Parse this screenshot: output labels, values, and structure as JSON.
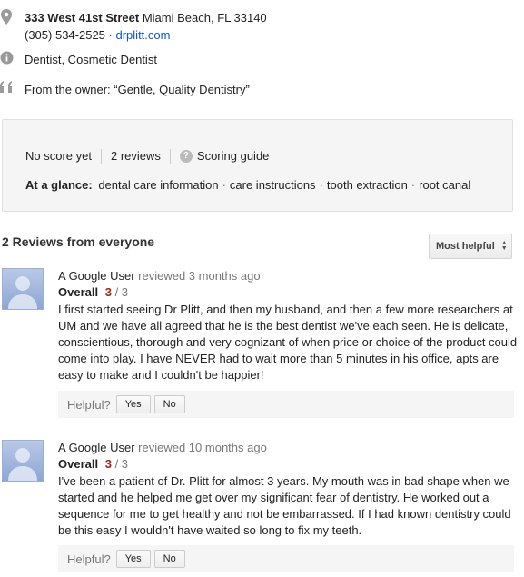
{
  "place": {
    "street": "333 West 41st Street",
    "city": "Miami Beach, FL 33140",
    "phone": "(305) 534-2525",
    "separator": "·",
    "website": "drplitt.com",
    "categories": "Dentist, Cosmetic Dentist",
    "owner_quote": "From the owner: “Gentle, Quality Dentistry”"
  },
  "score": {
    "status": "No score yet",
    "reviews_count": "2 reviews",
    "guide_label": "Scoring guide",
    "glance_label": "At a glance:",
    "glance_items": [
      "dental care information",
      "care instructions",
      "tooth extraction",
      "root canal"
    ]
  },
  "reviews_section": {
    "heading": "2 Reviews from everyone",
    "sort_label": "Most helpful"
  },
  "reviews": [
    {
      "author": "A Google User",
      "meta": "reviewed 3 months ago",
      "overall_label": "Overall",
      "score": "3",
      "outof": "/ 3",
      "text": "I first started seeing Dr Plitt, and then my husband, and then a few more researchers at UM and we have all agreed that he is the best dentist we've each seen. He is delicate, conscientious, thorough and very cognizant of when price or choice of the product could come into play. I have NEVER had to wait more than 5 minutes in his office, apts are easy to make and I couldn't be happier!",
      "helpful_label": "Helpful?",
      "yes_label": "Yes",
      "no_label": "No"
    },
    {
      "author": "A Google User",
      "meta": "reviewed 10 months ago",
      "overall_label": "Overall",
      "score": "3",
      "outof": "/ 3",
      "text": "I've been a patient of Dr. Plitt for almost 3 years. My mouth was in bad shape when we started and he helped me get over my significant fear of dentistry. He worked out a sequence for me to get healthy and not be embarrassed. If I had known dentistry could be this easy I wouldn't have waited so long to fix my teeth.",
      "helpful_label": "Helpful?",
      "yes_label": "Yes",
      "no_label": "No"
    }
  ],
  "icons": {
    "address": "map-pin-icon",
    "info": "info-icon",
    "quote": "quote-icon",
    "help": "help-icon",
    "sort": "sort-arrows-icon"
  },
  "colors": {
    "link": "#1155cc",
    "score": "#a1271b",
    "panel_bg": "#f5f5f5"
  }
}
